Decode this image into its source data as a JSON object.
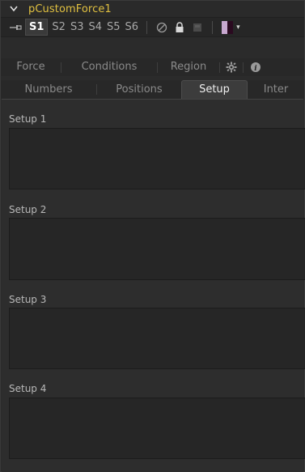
{
  "header": {
    "tool_name": "pCustomForce1"
  },
  "toolbar": {
    "slots": [
      "S1",
      "S2",
      "S3",
      "S4",
      "S5",
      "S6"
    ],
    "active_slot": "S1",
    "swatch_colors": [
      "#c8a8d0",
      "#2a0a20"
    ]
  },
  "tabs": {
    "row1": [
      {
        "label": "Force"
      },
      {
        "label": "Conditions"
      },
      {
        "label": "Region"
      }
    ],
    "row2": [
      {
        "label": "Numbers"
      },
      {
        "label": "Positions"
      },
      {
        "label": "Setup"
      },
      {
        "label": "Inter"
      }
    ],
    "active": "Setup"
  },
  "setups": [
    {
      "label": "Setup 1"
    },
    {
      "label": "Setup 2"
    },
    {
      "label": "Setup 3"
    },
    {
      "label": "Setup 4"
    }
  ],
  "icons": {
    "collapse": "chevron-down-icon",
    "pin": "pin-icon",
    "disable": "disable-icon",
    "lock": "lock-icon",
    "cache": "cache-icon",
    "settings": "gear-icon",
    "info": "info-icon"
  }
}
